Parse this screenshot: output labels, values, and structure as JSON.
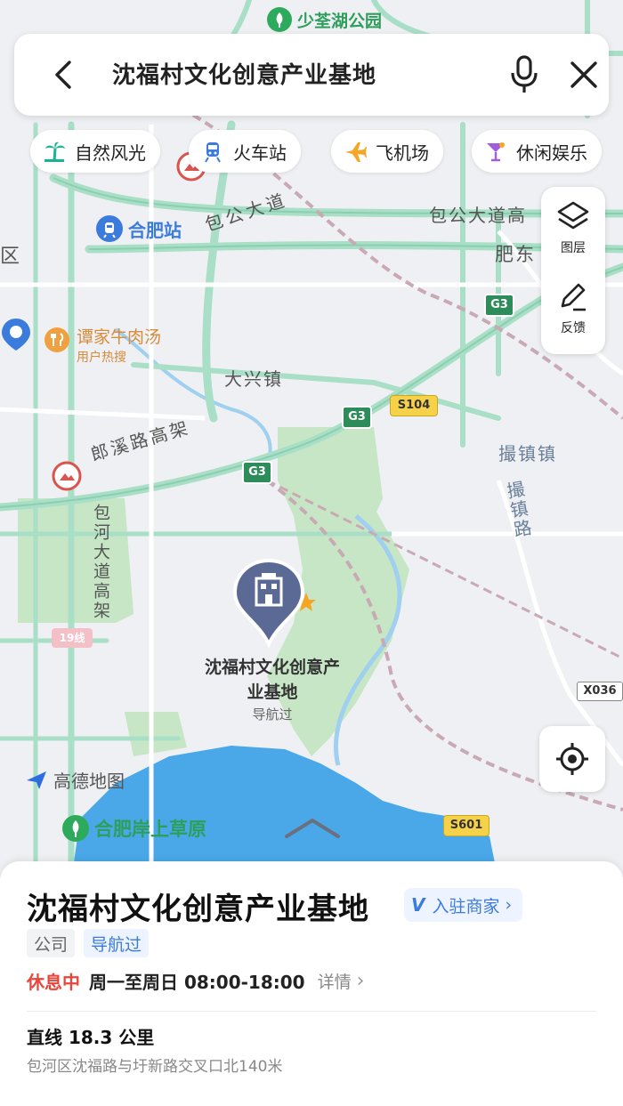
{
  "search": {
    "query": "沈福村文化创意产业基地"
  },
  "chips": [
    {
      "label": "自然风光",
      "icon": "palm-tree-icon",
      "color": "#19b394"
    },
    {
      "label": "火车站",
      "icon": "train-icon",
      "color": "#3b7bdc"
    },
    {
      "label": "飞机场",
      "icon": "airplane-icon",
      "color": "#f5a623"
    },
    {
      "label": "休闲娱乐",
      "icon": "cocktail-icon",
      "color": "#a25ddc"
    }
  ],
  "side_tools": {
    "layers_label": "图层",
    "feedback_label": "反馈"
  },
  "map": {
    "labels": {
      "park_top": "少荃湖公园",
      "qu": "区",
      "hefei_station": "合肥站",
      "baogong_road": "包公大道",
      "baogong_road_high": "包公大道高",
      "feidong": "肥东",
      "tan_beef": "谭家牛肉汤",
      "user_hot": "用户热搜",
      "daxing_town": "大兴镇",
      "langxi_road": "郎溪路高架",
      "cuozhen_town": "撮镇镇",
      "cuozhen_road": "撮镇路",
      "baohe_road": "包河大道高架",
      "hefei_grassland": "合肥岸上草原",
      "shield_g3_a": "G3",
      "shield_g3_b": "G3",
      "shield_g3_c": "G3",
      "shield_s104": "S104",
      "shield_s601": "S601",
      "shield_x036": "X036",
      "shield_19": "19线"
    },
    "brand": "高德地图",
    "pin": {
      "name": "沈福村文化创意产业基地",
      "sub": "导航过"
    }
  },
  "sheet": {
    "title": "沈福村文化创意产业基地",
    "merchant_badge": "V",
    "merchant_label": "入驻商家",
    "tags": [
      "公司",
      "导航过"
    ],
    "status": "休息中",
    "hours": "周一至周日 08:00-18:00",
    "detail": "详情",
    "distance": "直线 18.3 公里",
    "address": "包河区沈福路与圩新路交叉口北140米"
  },
  "colors": {
    "road_green": "#a8dfc6",
    "road_border": "#8ccfb0",
    "water": "#4aa8e8",
    "park": "#c7e6c5",
    "accent_blue": "#3b7bdc",
    "status_red": "#e8453c"
  }
}
